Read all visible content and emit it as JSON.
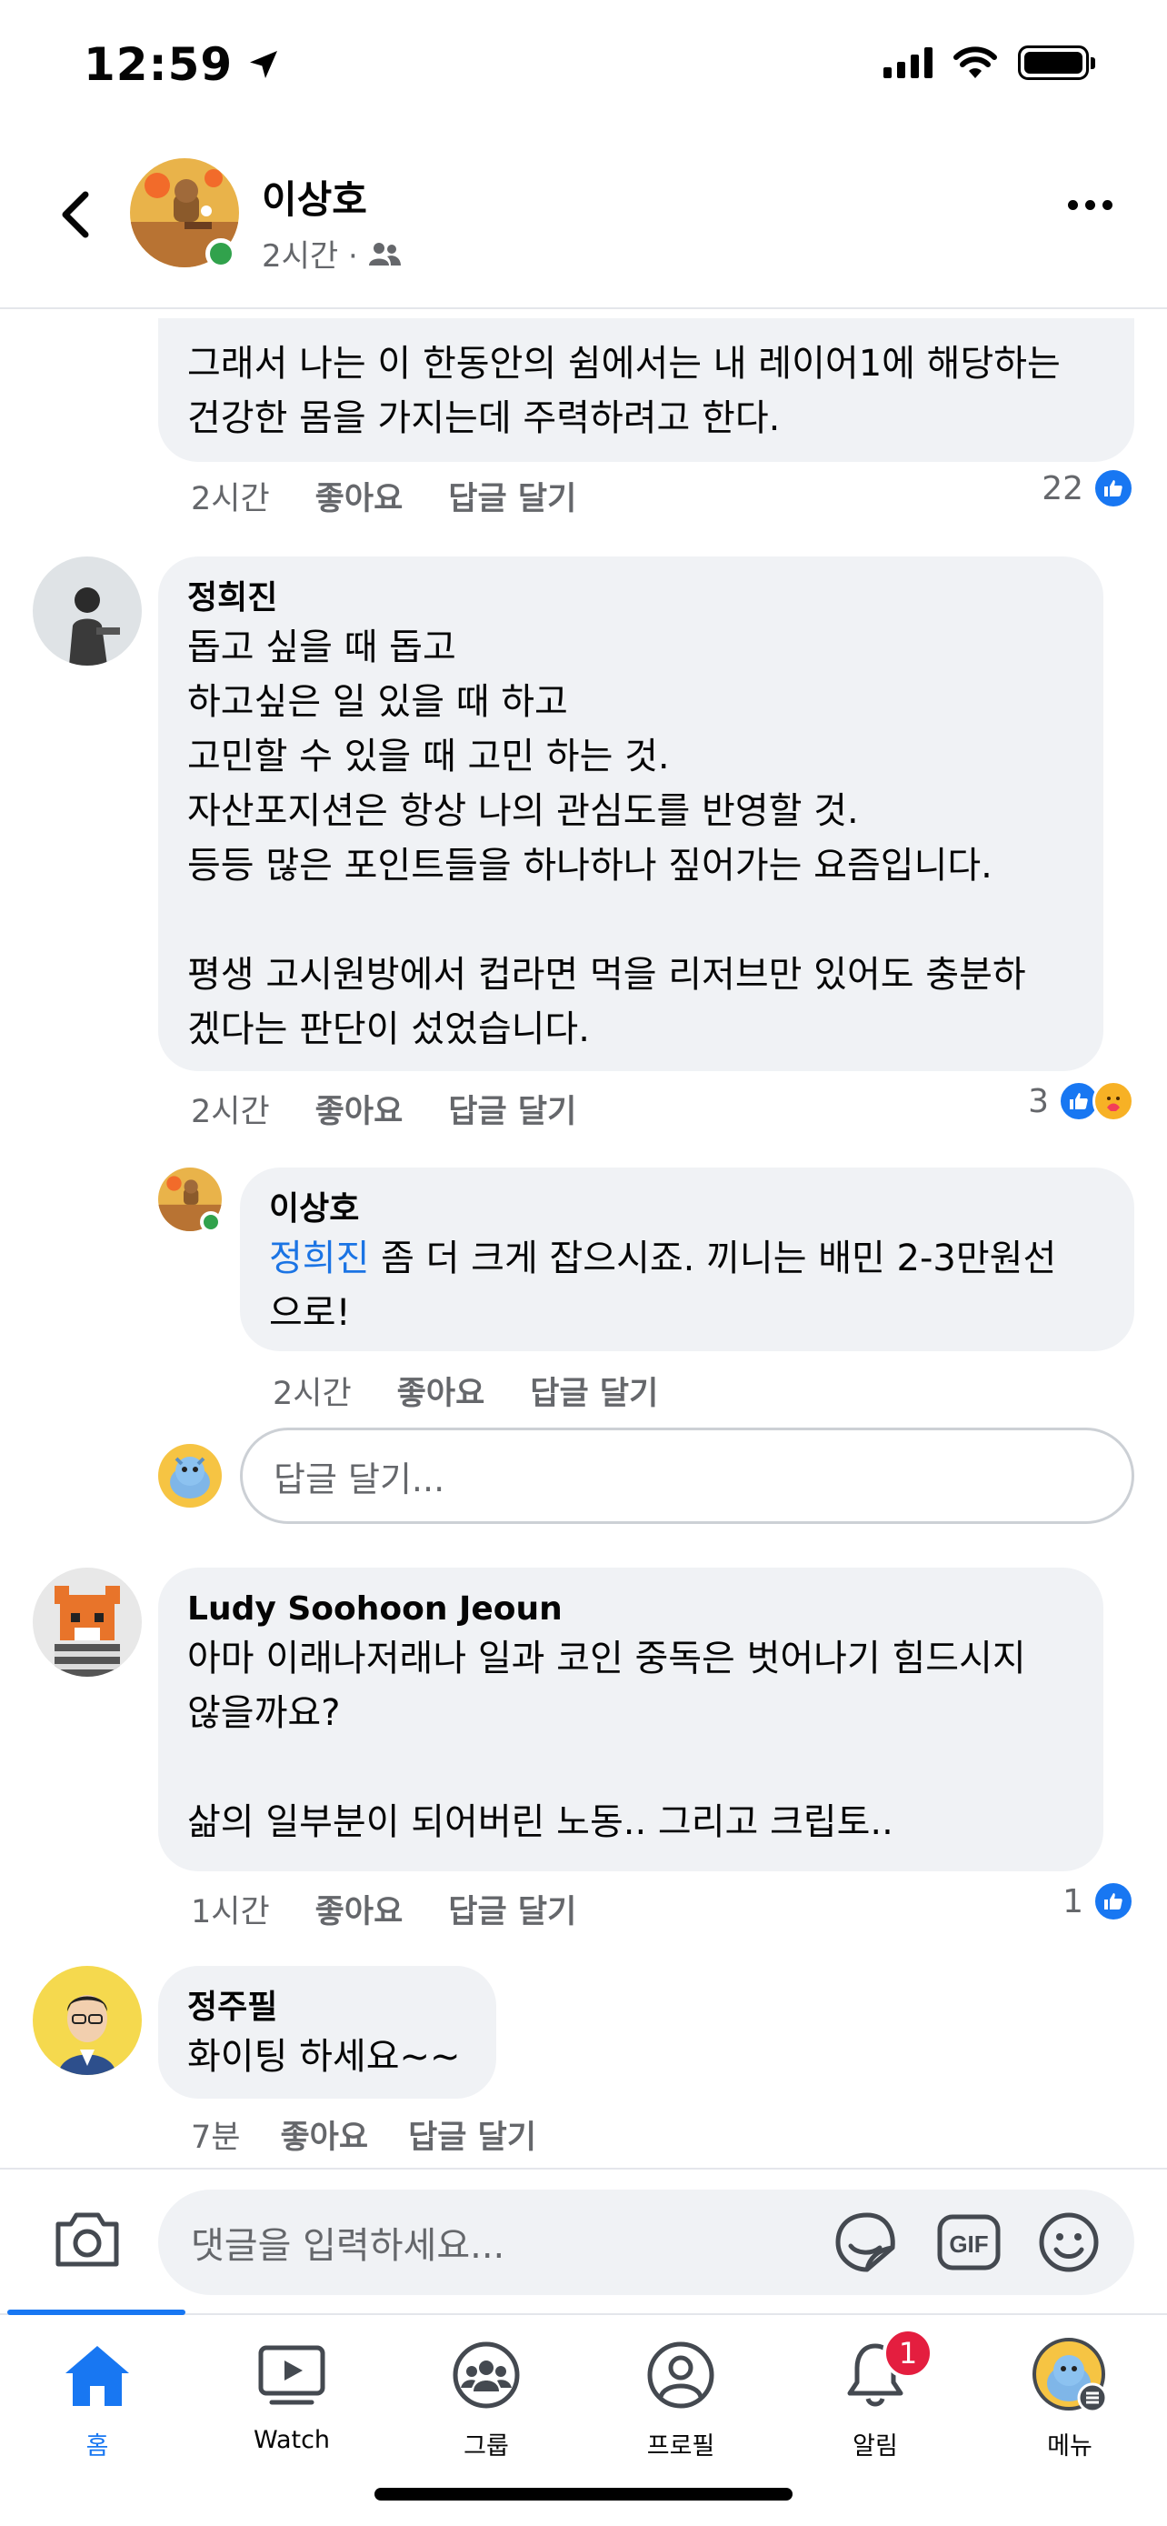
{
  "status_bar": {
    "time": "12:59"
  },
  "header": {
    "back_icon": "chevron-left-icon",
    "author_name": "이상호",
    "time": "2시간 ·",
    "audience_icon": "friends-icon",
    "more_icon": "ellipsis-icon"
  },
  "comments": [
    {
      "body": "그래서 나는 이 한동안의 쉼에서는 내 레이어1에 해당하는\n건강한 몸을 가지는데 주력하려고 한다.",
      "time": "2시간",
      "like_label": "좋아요",
      "reply_label": "답글 달기",
      "reaction_count": "22"
    },
    {
      "author": "정희진",
      "body": "돕고 싶을 때 돕고\n하고싶은 일 있을 때 하고\n고민할 수 있을 때 고민 하는 것.\n자산포지션은 항상 나의 관심도를 반영할 것.\n등등 많은 포인트들을 하나하나 짚어가는 요즘입니다.\n\n평생 고시원방에서 컵라면 먹을 리저브만 있어도 충분하\n겠다는 판단이 섰었습니다.",
      "time": "2시간",
      "like_label": "좋아요",
      "reply_label": "답글 달기",
      "reaction_count": "3"
    },
    {
      "author": "이상호",
      "mention": "정희진",
      "body_line1": " 좀 더 크게 잡으시죠. 끼니는 배민 2-3만원선",
      "body_line2": "으로!",
      "time": "2시간",
      "like_label": "좋아요",
      "reply_label": "답글 달기"
    },
    {
      "author": "Ludy Soohoon Jeoun",
      "body": "아마 이래나저래나 일과 코인 중독은 벗어나기 힘드시지\n않을까요?\n\n삶의 일부분이 되어버린 노동.. 그리고 크립토..",
      "time": "1시간",
      "like_label": "좋아요",
      "reply_label": "답글 달기",
      "reaction_count": "1"
    },
    {
      "author": "정주필",
      "body": "화이팅 하세요~~",
      "time": "7분",
      "like_label": "좋아요",
      "reply_label": "답글 달기"
    }
  ],
  "reply_input": {
    "placeholder": "답글 달기..."
  },
  "composer": {
    "placeholder": "댓글을 입력하세요...",
    "gif_label": "GIF"
  },
  "bottom_nav": [
    {
      "label": "홈",
      "icon": "home-icon",
      "active": true
    },
    {
      "label": "Watch",
      "icon": "watch-icon"
    },
    {
      "label": "그룹",
      "icon": "groups-icon"
    },
    {
      "label": "프로필",
      "icon": "profile-icon"
    },
    {
      "label": "알림",
      "icon": "bell-icon",
      "badge": "1"
    },
    {
      "label": "메뉴",
      "icon": "menu-avatar-icon"
    }
  ],
  "colors": {
    "accent": "#1877f2",
    "bubble": "#f0f2f5",
    "muted": "#65676b",
    "badge": "#e41e3f",
    "online": "#31a24c"
  }
}
